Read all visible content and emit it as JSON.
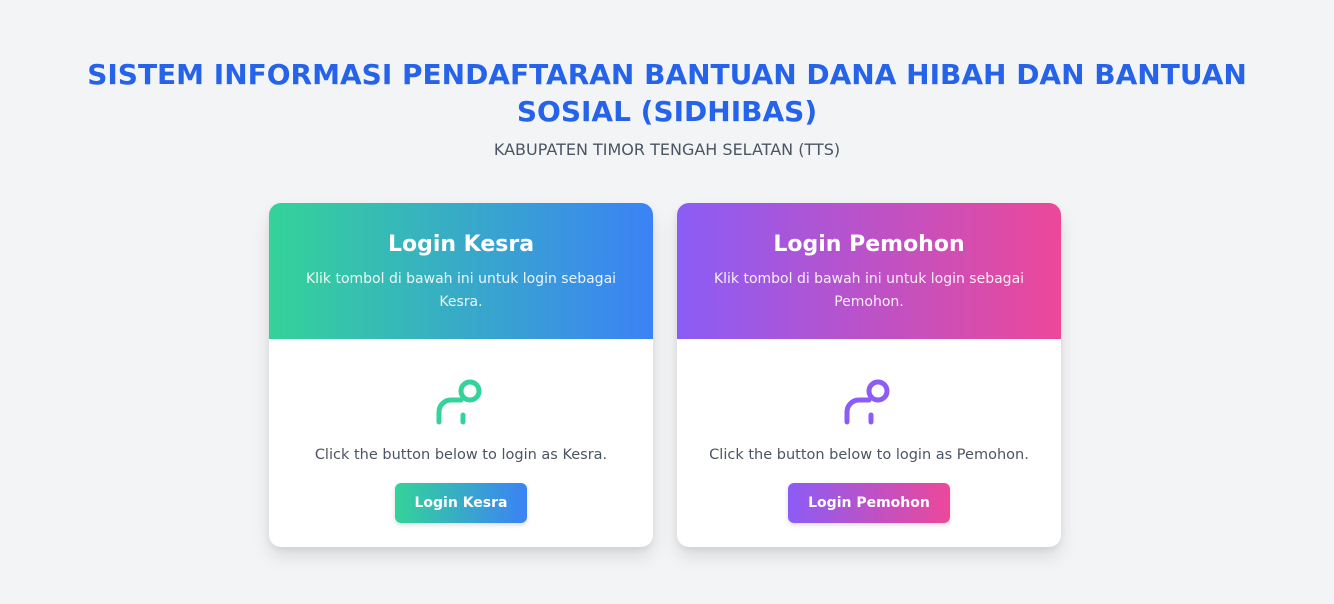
{
  "header": {
    "title": "SISTEM INFORMASI PENDAFTARAN BANTUAN DANA HIBAH DAN BANTUAN SOSIAL (SIDHIBAS)",
    "subtitle": "KABUPATEN TIMOR TENGAH SELATAN (TTS)"
  },
  "cards": [
    {
      "title": "Login Kesra",
      "description": "Klik tombol di bawah ini untuk login sebagai Kesra.",
      "icon": "user-icon",
      "body_text": "Click the button below to login as Kesra.",
      "button_label": "Login Kesra",
      "accent_colors": [
        "#34d399",
        "#3b82f6"
      ]
    },
    {
      "title": "Login Pemohon",
      "description": "Klik tombol di bawah ini untuk login sebagai Pemohon.",
      "icon": "user-icon",
      "body_text": "Click the button below to login as Pemohon.",
      "button_label": "Login Pemohon",
      "accent_colors": [
        "#8b5cf6",
        "#ec4899"
      ]
    }
  ],
  "colors": {
    "background": "#f3f4f6",
    "title": "#2563eb"
  }
}
